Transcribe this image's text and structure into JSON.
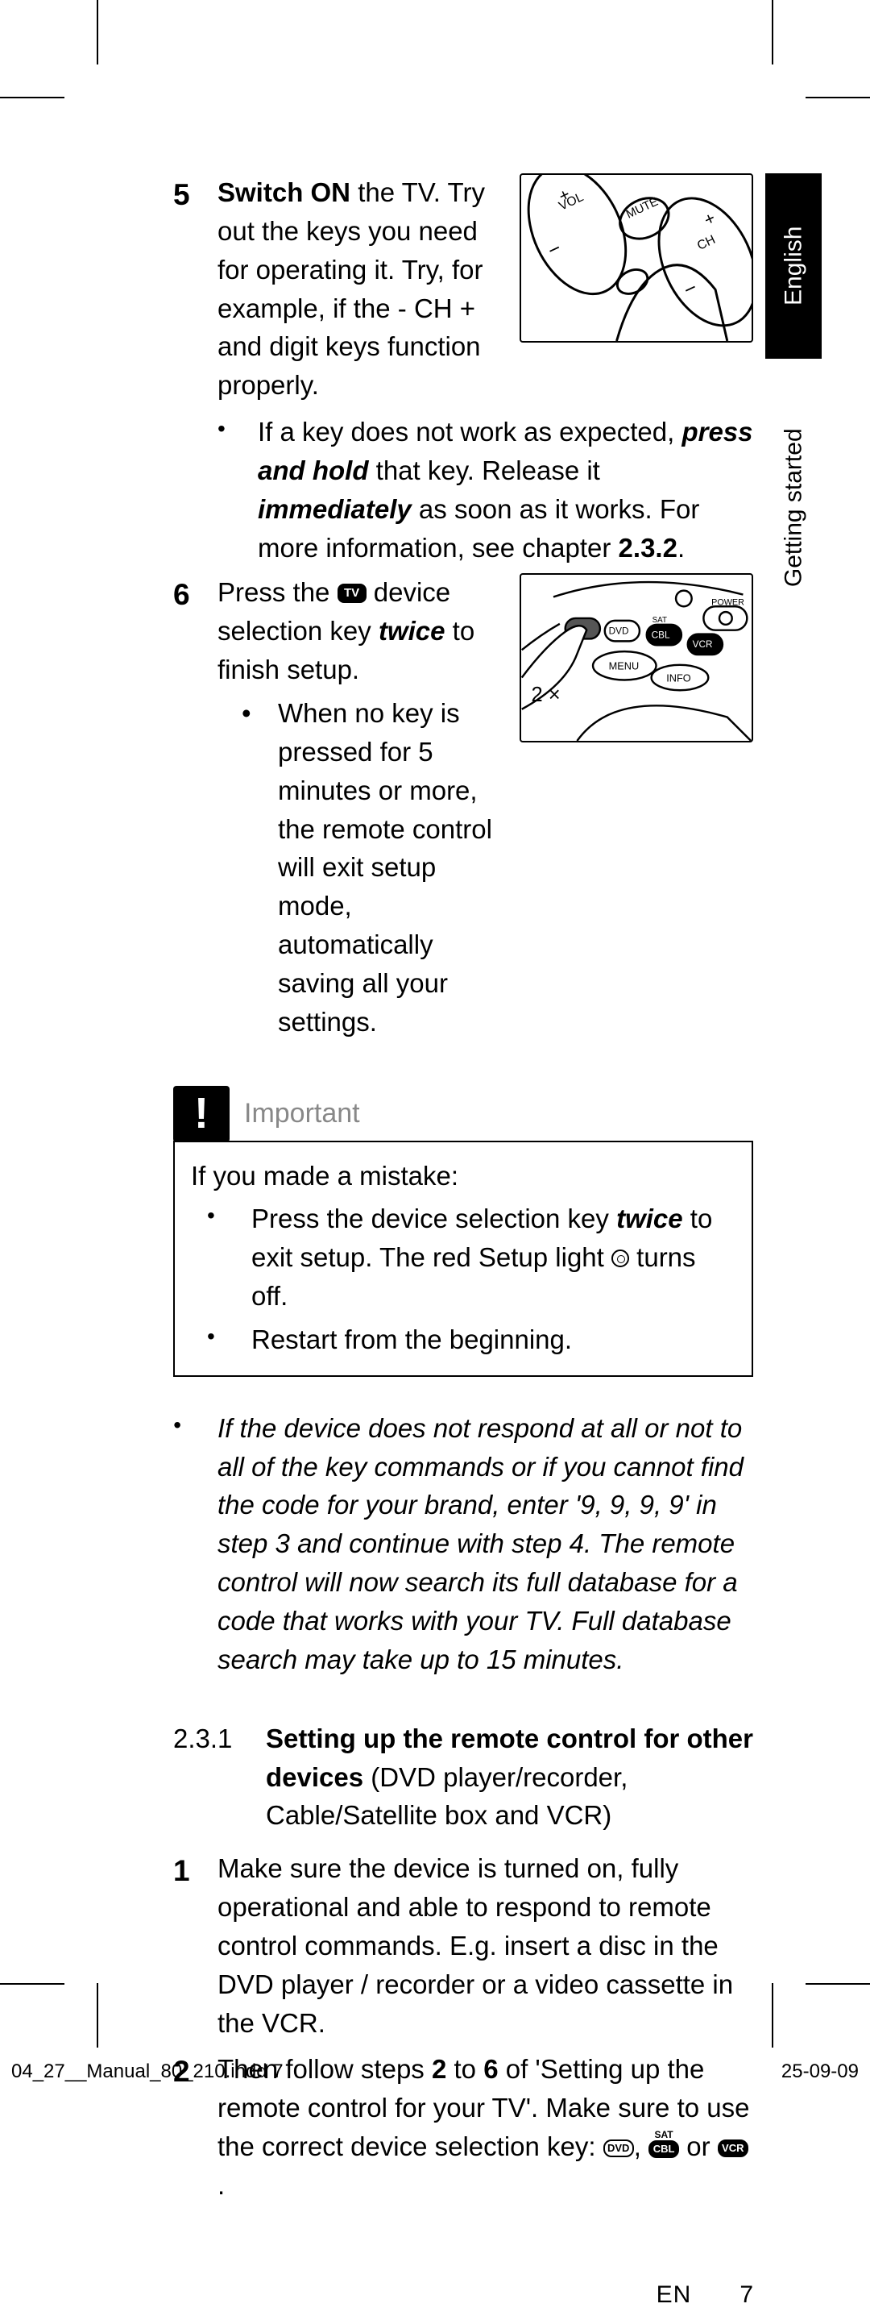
{
  "sideTabs": {
    "english": "English",
    "getting": "Getting started"
  },
  "step5": {
    "num": "5",
    "line1a": "Switch ON",
    "line1b": " the TV. Try out the keys you need for operating it. Try, for example, if the - CH + and digit keys function properly."
  },
  "step5bullet": {
    "a": "If a key does not work as expected, ",
    "b": "press and hold",
    "c": " that key. Release it ",
    "d": "immediately",
    "e": " as soon as it works. For more information, see chapter ",
    "f": "2.3.2",
    "g": "."
  },
  "step6": {
    "num": "6",
    "a": "Press the ",
    "tv": "TV",
    "b": " device selection key ",
    "c": "twice",
    "d": " to finish setup.",
    "sub": "When no key is pressed for 5 minutes or more, the remote control will exit setup mode, automatically saving all your settings.",
    "fig2x": "2 ×"
  },
  "important": {
    "label": "Important",
    "intro": "If you made a mistake:",
    "b1a": "Press the device selection key ",
    "b1b": "twice",
    "b1c": " to exit setup. The red Setup light ",
    "b1d": " turns off.",
    "b2": "Restart from the beginning."
  },
  "italicNote": "If the device does not respond at all or not to all of the key commands or if you cannot find the code for your brand, enter '9, 9, 9, 9' in step 3 and continue with step 4. The remote control will now search its full database for a code that works with your TV. Full database search may take up to 15 minutes.",
  "sec231": {
    "num": "2.3.1",
    "titleStrong": "Setting up the remote control for other devices",
    "titleRest": " (DVD player/recorder, Cable/Satellite box and VCR)"
  },
  "step1": {
    "num": "1",
    "text": "Make sure the device is turned on, fully operational and able to respond to remote control commands. E.g. insert a disc in the DVD player / recorder or a video cassette in the VCR."
  },
  "step2": {
    "num": "2",
    "a": "Then follow steps ",
    "b": "2",
    "c": " to ",
    "d": "6",
    "e": " of  'Setting up the remote control for your TV'. Make sure to use the correct device selection key: ",
    "dvd": "DVD",
    "sat": "SAT",
    "cbl": "CBL",
    "or": " or ",
    "vcr": "VCR",
    "end": "."
  },
  "footer": {
    "lang": "EN",
    "page": "7"
  },
  "indd": {
    "file": "04_27__Manual_80_210.indd   7",
    "date": "25-09-09"
  },
  "fig1": {
    "vol": "VOL",
    "mute": "MUTE",
    "ch": "CH"
  },
  "fig2": {
    "power": "POWER",
    "menu": "MENU",
    "info": "INFO",
    "dvd": "DVD",
    "sat": "SAT",
    "cbl": "CBL",
    "vcr": "VCR"
  }
}
